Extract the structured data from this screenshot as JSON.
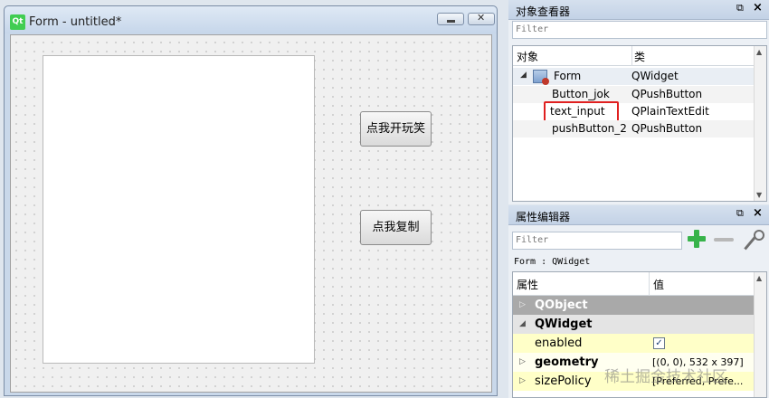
{
  "form": {
    "title": "Form - untitled*",
    "logo": "Qt",
    "buttons": {
      "joke": "点我开玩笑",
      "copy": "点我复制"
    }
  },
  "object_inspector": {
    "title": "对象查看器",
    "filter_placeholder": "Filter",
    "columns": {
      "object": "对象",
      "class": "类"
    },
    "rows": [
      {
        "name": "Form",
        "class": "QWidget"
      },
      {
        "name": "Button_jok",
        "class": "QPushButton"
      },
      {
        "name": "text_input",
        "class": "QPlainTextEdit"
      },
      {
        "name": "pushButton_2",
        "class": "QPushButton"
      }
    ],
    "highlight_color": "#e02020"
  },
  "property_editor": {
    "title": "属性编辑器",
    "filter_placeholder": "Filter",
    "class_label": "Form : QWidget",
    "columns": {
      "property": "属性",
      "value": "值"
    },
    "rows": [
      {
        "name": "QObject",
        "value": ""
      },
      {
        "name": "QWidget",
        "value": ""
      },
      {
        "name": "enabled",
        "value": "✓"
      },
      {
        "name": "geometry",
        "value": "[(0, 0), 532 x 397]"
      },
      {
        "name": "sizePolicy",
        "value": "[Preferred, Prefe..."
      }
    ]
  },
  "watermark": "稀土掘金技术社区"
}
